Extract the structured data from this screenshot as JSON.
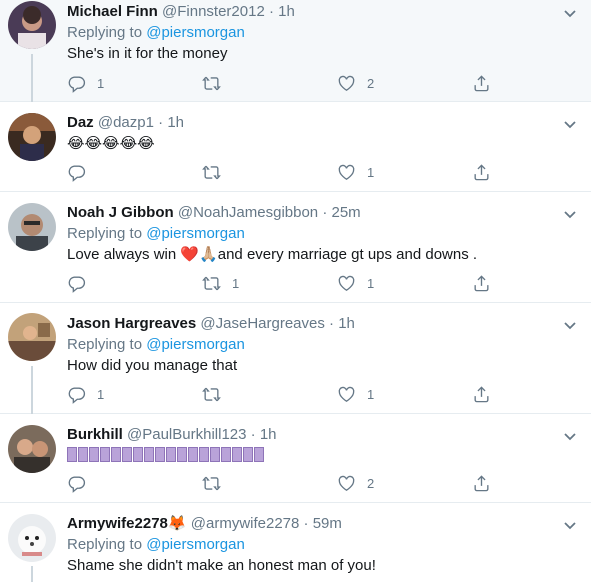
{
  "colors": {
    "accent": "#1b95e0",
    "muted": "#657786",
    "divider": "#e6ecf0",
    "like": "#e0245e"
  },
  "tweets": [
    {
      "name": "Michael Finn",
      "handle": "@Finnster2012",
      "sep": "·",
      "time": "1h",
      "replying_prefix": "Replying to",
      "replying_to": "@piersmorgan",
      "text": "She's in it for the money",
      "reply_count": "1",
      "retweet_count": "",
      "like_count": "2"
    },
    {
      "name": "Daz",
      "handle": "@dazp1",
      "sep": "·",
      "time": "1h",
      "text": "😂😂😂😂😂",
      "reply_count": "",
      "retweet_count": "",
      "like_count": "1"
    },
    {
      "name": "Noah J Gibbon",
      "handle": "@NoahJamesgibbon",
      "sep": "·",
      "time": "25m",
      "replying_prefix": "Replying to",
      "replying_to": "@piersmorgan",
      "text_before": "Love always win ",
      "text_emoji": "❤️🙏🏼",
      "text_after": "and every marriage gt ups and downs .",
      "reply_count": "",
      "retweet_count": "1",
      "like_count": "1"
    },
    {
      "name": "Jason Hargreaves",
      "handle": "@JaseHargreaves",
      "sep": "·",
      "time": "1h",
      "replying_prefix": "Replying to",
      "replying_to": "@piersmorgan",
      "text": "How did you manage that",
      "reply_count": "1",
      "retweet_count": "",
      "like_count": "1"
    },
    {
      "name": "Burkhill",
      "handle": "@PaulBurkhill123",
      "sep": "·",
      "time": "1h",
      "glyph_count": 18,
      "reply_count": "",
      "retweet_count": "",
      "like_count": "2"
    },
    {
      "name": "Armywife2278",
      "name_emoji": "🦊",
      "handle": "@armywife2278",
      "sep": "·",
      "time": "59m",
      "replying_prefix": "Replying to",
      "replying_to": "@piersmorgan",
      "text": "Shame she didn't make an honest man of you!"
    }
  ],
  "icons": {
    "reply": "reply-icon",
    "retweet": "retweet-icon",
    "like": "heart-icon",
    "share": "share-icon",
    "menu": "chevron-down-icon"
  }
}
